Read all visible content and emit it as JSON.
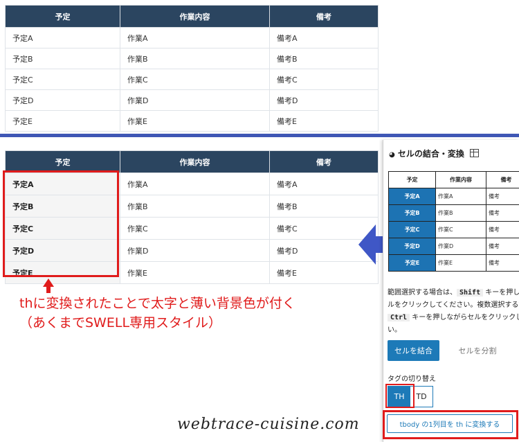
{
  "table_top": {
    "headers": [
      "予定",
      "作業内容",
      "備考"
    ],
    "rows": [
      [
        "予定A",
        "作業A",
        "備考A"
      ],
      [
        "予定B",
        "作業B",
        "備考B"
      ],
      [
        "予定C",
        "作業C",
        "備考C"
      ],
      [
        "予定D",
        "作業D",
        "備考D"
      ],
      [
        "予定E",
        "作業E",
        "備考E"
      ]
    ]
  },
  "table_bottom": {
    "headers": [
      "予定",
      "作業内容",
      "備考"
    ],
    "rows": [
      [
        "予定A",
        "作業A",
        "備考A"
      ],
      [
        "予定B",
        "作業B",
        "備考B"
      ],
      [
        "予定C",
        "作業C",
        "備考C"
      ],
      [
        "予定D",
        "作業D",
        "備考D"
      ],
      [
        "予定E",
        "作業E",
        "備考E"
      ]
    ]
  },
  "annotation": {
    "line1": "thに変換されたことで太字と薄い背景色が付く",
    "line2": "（あくまでSWELL専用スタイル）"
  },
  "panel": {
    "title": "セルの結合・変換",
    "mini_headers": [
      "予定",
      "作業内容",
      "備考"
    ],
    "mini_rows": [
      [
        "予定A",
        "作業A",
        "備考"
      ],
      [
        "予定B",
        "作業B",
        "備考"
      ],
      [
        "予定C",
        "作業C",
        "備考"
      ],
      [
        "予定D",
        "作業D",
        "備考"
      ],
      [
        "予定E",
        "作業E",
        "備考"
      ]
    ],
    "help_prefix": "範囲選択する場合は、",
    "help_shift": "Shift",
    "help_mid": " キーを押しながらセルをクリックしてください。複数選択する場合は、",
    "help_ctrl": "Ctrl",
    "help_suffix": " キーを押しながらセルをクリックしてください。",
    "merge_label": "セルを結合",
    "split_label": "セルを分割",
    "tag_switch_label": "タグの切り替え",
    "th_label": "TH",
    "td_label": "TD",
    "convert_label": "tbody の1列目を th に変換する"
  },
  "watermark": "webtrace-cuisine.com",
  "colors": {
    "header_bg": "#2b4560",
    "accent_red": "#e01b1b",
    "accent_blue": "#1d73b3",
    "separator": "#3f57b5",
    "arrow_blue": "#3f57c6"
  }
}
